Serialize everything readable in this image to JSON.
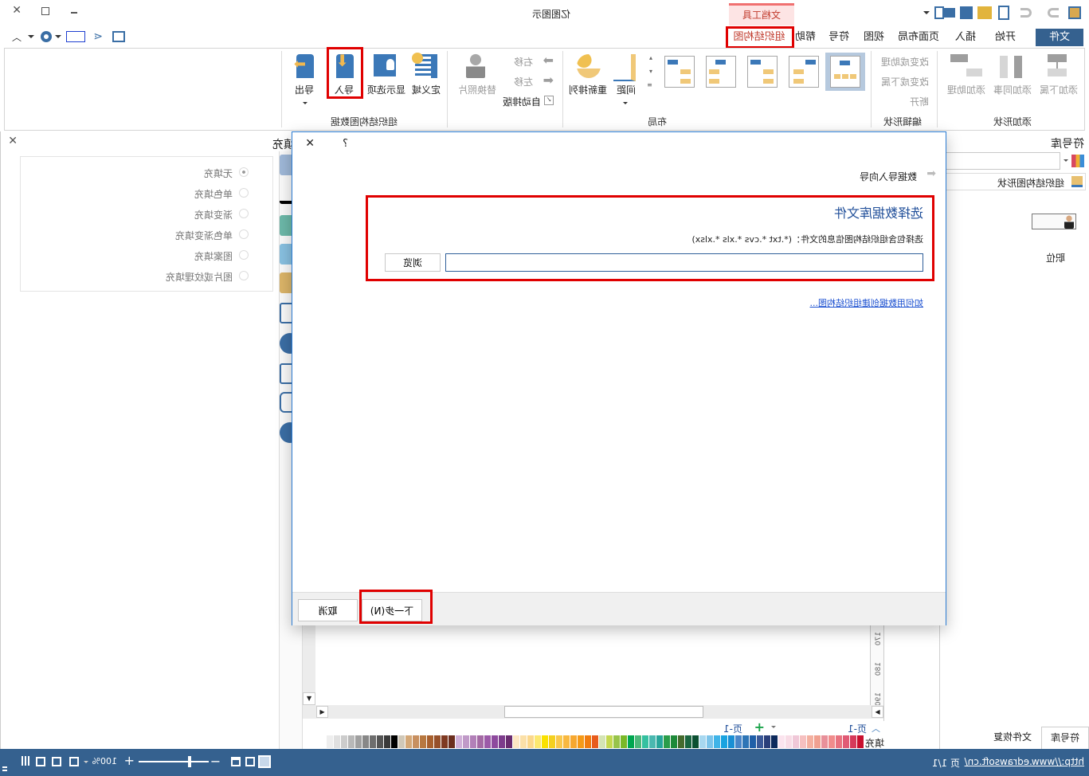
{
  "app": {
    "title": "亿图图示",
    "context_tab_group": "文档工具"
  },
  "window_controls": {
    "minimize": "minimize-icon",
    "maximize": "maximize-icon",
    "close": "close-icon"
  },
  "ribbon_tabs": [
    {
      "label": "文件",
      "active": true
    },
    {
      "label": "开始"
    },
    {
      "label": "插入"
    },
    {
      "label": "页面布局"
    },
    {
      "label": "视图"
    },
    {
      "label": "符号"
    },
    {
      "label": "帮助"
    },
    {
      "label": "组织结构图",
      "highlighted": true
    }
  ],
  "ribbon": {
    "add_shape": {
      "label": "添加形状",
      "buttons": [
        "添加下属",
        "添加同事",
        "添加助理"
      ]
    },
    "edit_shape": {
      "label": "编辑形状",
      "buttons": [
        "改变成助理",
        "改变成下属",
        "断开"
      ]
    },
    "layout": {
      "label": "布局",
      "spacing": "间距",
      "rearrange": "重新排列",
      "move_right": "右移",
      "move_left": "左移",
      "auto_layout": "自动排版",
      "replace_photo": "替换照片"
    },
    "org_data": {
      "label": "组织结构图数据",
      "define": "定义域",
      "display_options": "显示选项",
      "import": "导入",
      "export": "导出"
    }
  },
  "symbol_library": {
    "title": "符号库",
    "search_value": "",
    "category": "组织结构图形状",
    "shape_label": "职位"
  },
  "fill_panel": {
    "title": "填充",
    "options": [
      {
        "label": "无填充",
        "selected": true
      },
      {
        "label": "单色填充",
        "selected": false
      },
      {
        "label": "渐变填充",
        "selected": false
      },
      {
        "label": "单色渐变填充",
        "selected": false
      },
      {
        "label": "图案填充",
        "selected": false
      },
      {
        "label": "图片或纹理填充",
        "selected": false
      }
    ]
  },
  "dialog": {
    "help": "?",
    "wizard_title": "数据导入向导",
    "heading": "选择数据库文件",
    "description": "选择包含组织结构图信息的文件：(*.txt  *.cvs  *.xls  *.xlsx)",
    "file_path": "",
    "browse": "浏览",
    "help_link": "如何用数据创建组织结构图...",
    "next": "下一步(N)",
    "cancel": "取消"
  },
  "ruler_marks": [
    "170",
    "180",
    "190"
  ],
  "page_tabs": {
    "current": "页-1",
    "tab": "页-1"
  },
  "palette_label": "填充",
  "palette": [
    "#c8102e",
    "#d63a5a",
    "#e05a75",
    "#e8727f",
    "#f08c8c",
    "#e8909a",
    "#f0a090",
    "#f4b0a0",
    "#f6c0c0",
    "#f0c8d8",
    "#f8dce6",
    "#fbe4ee",
    "#0d2a5c",
    "#2a3f7a",
    "#3b5998",
    "#1f5fa8",
    "#2e75b6",
    "#4a86c8",
    "#1a8fd4",
    "#1aa3e0",
    "#40b4e8",
    "#7cc4ea",
    "#a8d8f0",
    "#0c5032",
    "#1a6640",
    "#456b2e",
    "#1e8a3a",
    "#2a9d4a",
    "#27a59a",
    "#4ab8b0",
    "#35c0a0",
    "#4cb87a",
    "#00a650",
    "#7ab828",
    "#98c44a",
    "#c4d850",
    "#d4e4b4",
    "#e85c1c",
    "#f07c10",
    "#f59a18",
    "#f7a830",
    "#f8b840",
    "#f9c84c",
    "#f4d020",
    "#fae200",
    "#fce870",
    "#fbd88c",
    "#fbe0a8",
    "#fde8c4",
    "#6a2c70",
    "#7d3c8c",
    "#8e4a9e",
    "#9c5aa8",
    "#a46aa4",
    "#b280b8",
    "#c09ac8",
    "#d0b0d8",
    "#6b2e1e",
    "#7f3a22",
    "#96502a",
    "#a8602e",
    "#b87840",
    "#c89060",
    "#d4a878",
    "#d0c8b8",
    "#000000",
    "#3a3a3a",
    "#555555",
    "#6e6e6e",
    "#888888",
    "#a0a0a0",
    "#b8b8b8",
    "#cccccc",
    "#e0e0e0",
    "#eeeeee"
  ],
  "bottom_tabs": [
    "符号库",
    "文件恢复"
  ],
  "status": {
    "url": "http://www.edrawsoft.cn/",
    "page": "页 1/1",
    "zoom": "100%"
  },
  "colors": {
    "accent": "#35618f",
    "highlight_box": "#e00000",
    "dialog_heading": "#1f4e99",
    "file_tab": "#35618f"
  }
}
